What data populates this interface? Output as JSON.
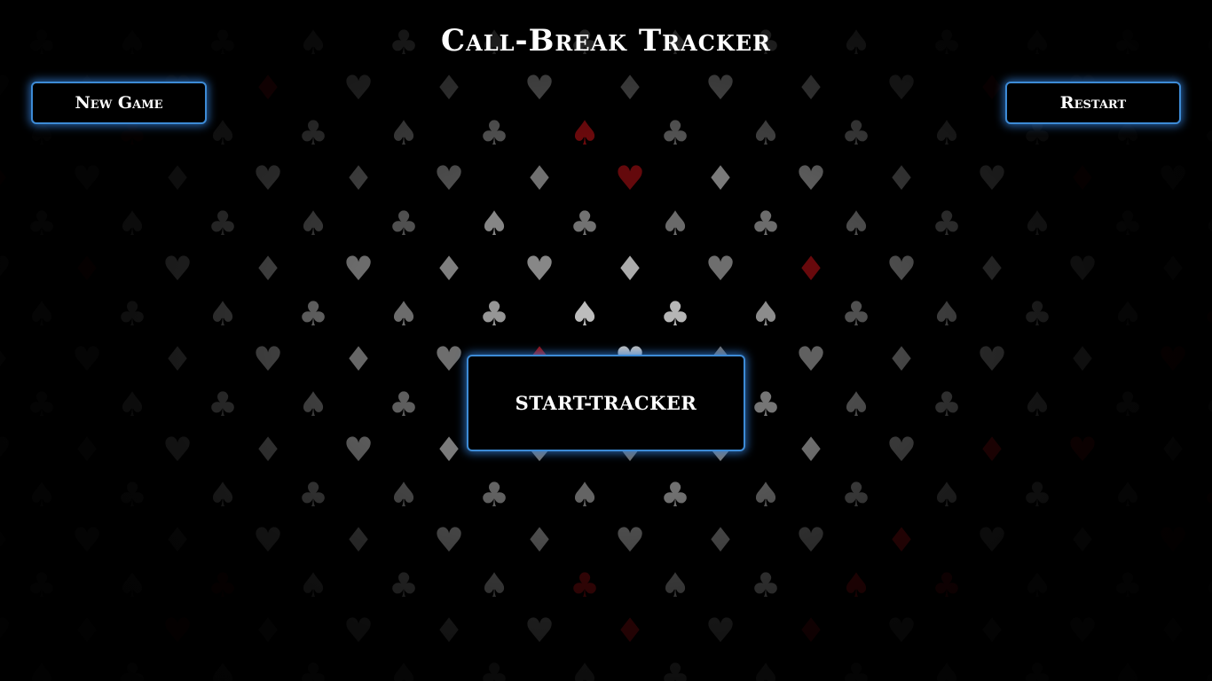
{
  "header": {
    "title": "Call-Break Tracker"
  },
  "buttons": {
    "new_game": "New Game",
    "restart": "Restart",
    "start_tracker": "START-TRACKER"
  },
  "background": {
    "pattern": "card-suits",
    "suits": [
      "heart-icon",
      "spade-icon",
      "diamond-icon",
      "club-icon"
    ],
    "colors": {
      "page": "#000000",
      "suit_light": "#c8c8c8",
      "suit_red": "#d4141a"
    }
  },
  "colors": {
    "button_border": "#3d8bd6",
    "button_glow": "#3482dc",
    "text": "#ffffff"
  }
}
